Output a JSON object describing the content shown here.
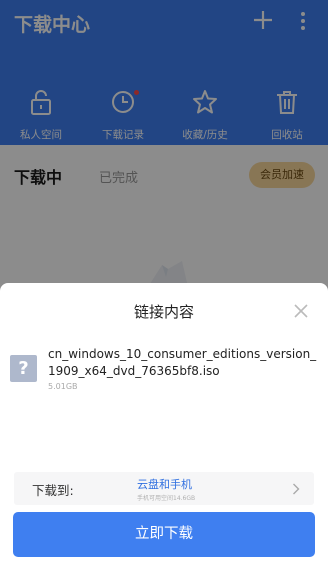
{
  "header": {
    "title": "下载中心"
  },
  "quick_actions": [
    {
      "label": "私人空间",
      "icon": "lock-icon"
    },
    {
      "label": "下载记录",
      "icon": "clock-icon"
    },
    {
      "label": "收藏/历史",
      "icon": "star-icon"
    },
    {
      "label": "回收站",
      "icon": "trash-icon"
    }
  ],
  "tabs": {
    "active": "下载中",
    "inactive": "已完成"
  },
  "vip_button": "会员加速",
  "sheet": {
    "title": "链接内容",
    "file_name": "cn_windows_10_consumer_editions_version_1909_x64_dvd_76365bf8.iso",
    "file_icon": "?",
    "file_size": "5.01GB",
    "dest_label": "下载到:",
    "dest_value": "云盘和手机",
    "dest_sub": "手机可用空间14.6GB",
    "download_button": "立即下载"
  },
  "colors": {
    "primary": "#3f7ff0",
    "vip": "#f7d79b",
    "dot": "#ff4b4b"
  }
}
